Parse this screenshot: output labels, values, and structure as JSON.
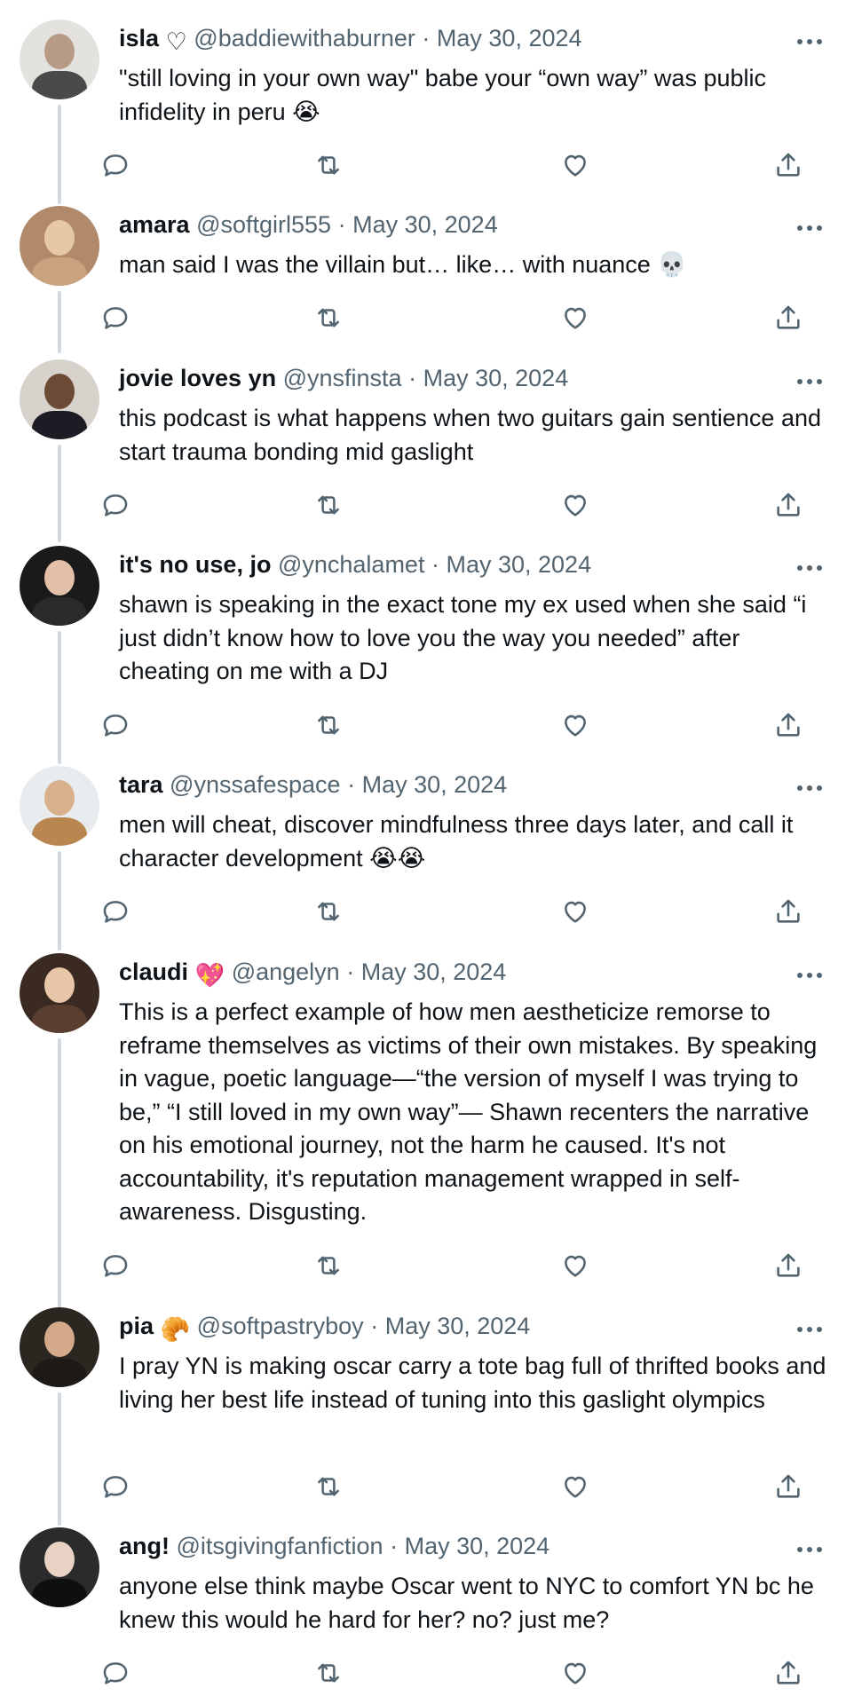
{
  "tweets": [
    {
      "name": "isla",
      "name_emoji": "♡",
      "handle": "@baddiewithaburner",
      "separator": "·",
      "date": "May 30, 2024",
      "text": "\"still loving in your own way\" babe your “own way” was public infidelity in peru 😭",
      "avatar_colors": {
        "bg": "#e4e2df",
        "face": "#b79b86",
        "body": "#4a4a4a"
      }
    },
    {
      "name": "amara",
      "name_emoji": "",
      "handle": "@softgirl555",
      "separator": "·",
      "date": "May 30, 2024",
      "text": "man said I was the villain but… like… with nuance 💀",
      "avatar_colors": {
        "bg": "#b08a6a",
        "face": "#e6c7a6",
        "body": "#c9a27e"
      }
    },
    {
      "name": "jovie loves yn",
      "name_emoji": "",
      "handle": "@ynsfinsta",
      "separator": "·",
      "date": "May 30, 2024",
      "text": "this podcast is what happens when two guitars gain sentience and start trauma bonding mid gaslight",
      "avatar_colors": {
        "bg": "#d8d2cc",
        "face": "#6b4a36",
        "body": "#1c1c24"
      }
    },
    {
      "name": "it's no use, jo",
      "name_emoji": "",
      "handle": "@ynchalamet",
      "separator": "·",
      "date": "May 30, 2024",
      "text": "shawn is speaking in the exact tone my ex used when she said “i just didn’t know how to love you the way you needed” after cheating on me with a DJ",
      "avatar_colors": {
        "bg": "#1a1a1a",
        "face": "#e3c0a8",
        "body": "#2a2a2a"
      }
    },
    {
      "name": "tara",
      "name_emoji": "",
      "handle": "@ynssafespace",
      "separator": "·",
      "date": "May 30, 2024",
      "text": "men will cheat, discover mindfulness three days later, and call it character development 😭😭",
      "avatar_colors": {
        "bg": "#e9ecef",
        "face": "#d9b08c",
        "body": "#b8864e"
      }
    },
    {
      "name": "claudi",
      "name_emoji": "💖",
      "handle": "@angelyn",
      "separator": "·",
      "date": "May 30, 2024",
      "text": "This is a perfect example of how men aestheticize remorse to reframe themselves as victims of their own mistakes. By speaking in vague, poetic language—“the version of myself I was trying to be,” “I still loved in my own way”— Shawn recenters the narrative on his emotional journey, not the harm he caused. It's not accountability, it's reputation management wrapped in self-awareness. Disgusting.",
      "avatar_colors": {
        "bg": "#3a2a22",
        "face": "#e8c6aa",
        "body": "#5a3f30"
      }
    },
    {
      "name": "pia",
      "name_emoji": "🥐",
      "handle": "@softpastryboy",
      "separator": "·",
      "date": "May 30, 2024",
      "text": "I pray YN is making oscar carry a tote bag full of thrifted books and living her best life instead of tuning into this gaslight olympics",
      "avatar_colors": {
        "bg": "#2c2620",
        "face": "#d4a98a",
        "body": "#1e1a18"
      }
    },
    {
      "name": "ang!",
      "name_emoji": "",
      "handle": "@itsgivingfanfiction",
      "separator": "·",
      "date": "May 30, 2024",
      "text": "anyone else think maybe Oscar went to NYC to comfort YN bc he knew this would he hard for her? no? just me?",
      "avatar_colors": {
        "bg": "#2b2b2b",
        "face": "#e7d2c4",
        "body": "#0f0f0f"
      }
    }
  ],
  "colors": {
    "text": "#0f1419",
    "secondary": "#536471",
    "thread_line": "#cfd9de"
  },
  "icons": [
    "reply-icon",
    "retweet-icon",
    "like-icon",
    "share-icon",
    "more-icon"
  ]
}
